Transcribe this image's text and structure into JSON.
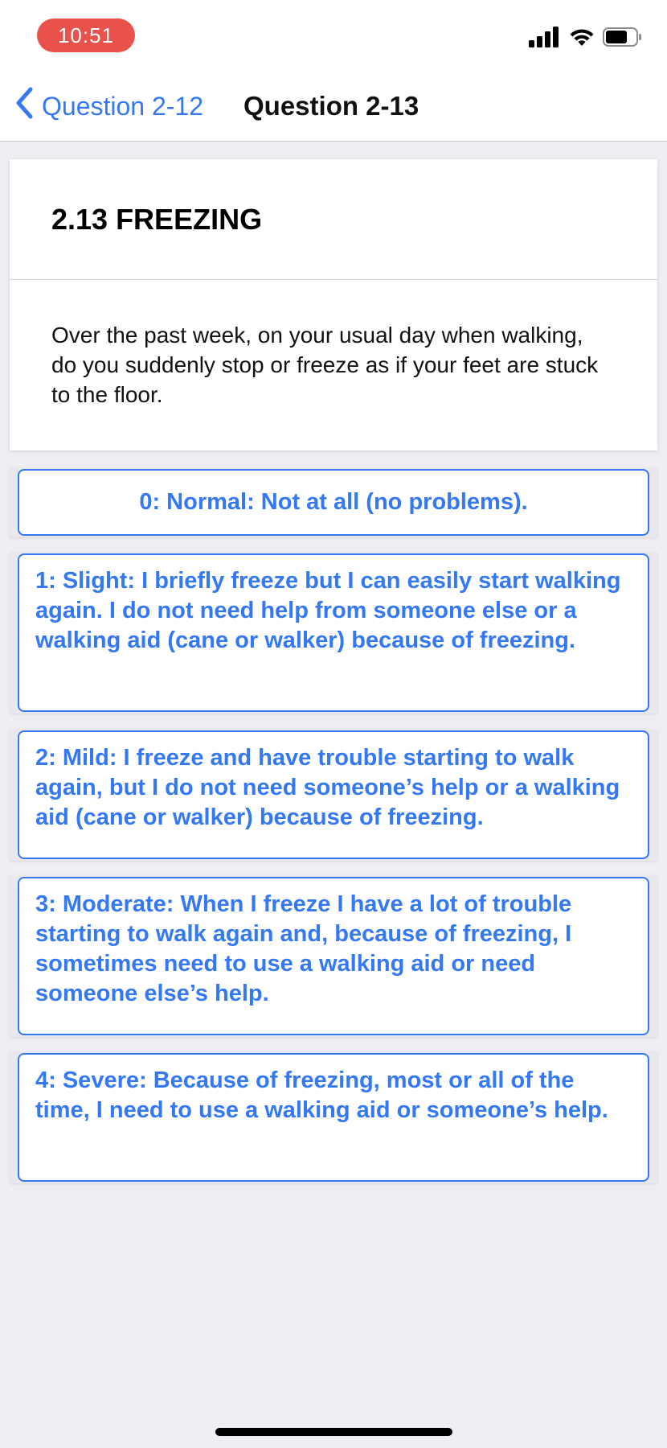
{
  "status_bar": {
    "time": "10:51",
    "icons": [
      "cellular-signal-icon",
      "wifi-icon",
      "battery-icon"
    ]
  },
  "nav": {
    "back_label": "Question 2-12",
    "title": "Question 2-13"
  },
  "question": {
    "title": "2.13 FREEZING",
    "text": "Over the past week, on your usual day when walking, do you suddenly stop or freeze as if your feet are stuck to the floor."
  },
  "options": [
    {
      "label": "0: Normal: Not at all (no problems)."
    },
    {
      "label": "1: Slight: I briefly freeze but I can easily start walking again. I do not need help from someone else or a walking aid (cane or walker) because of freezing."
    },
    {
      "label": "2: Mild: I freeze and have trouble starting to walk again, but I do not need someone’s help or a walking aid (cane or walker) because of freezing."
    },
    {
      "label": "3: Moderate: When I freeze I have a lot of trouble starting to walk again and, because of freezing, I sometimes need to use a walking aid or need someone else’s help."
    },
    {
      "label": "4: Severe: Because of freezing, most or all of the time, I need to use a walking aid or someone’s help."
    }
  ],
  "colors": {
    "accent": "#3478f6",
    "time_pill": "#e8524a",
    "background": "#efeef4"
  }
}
